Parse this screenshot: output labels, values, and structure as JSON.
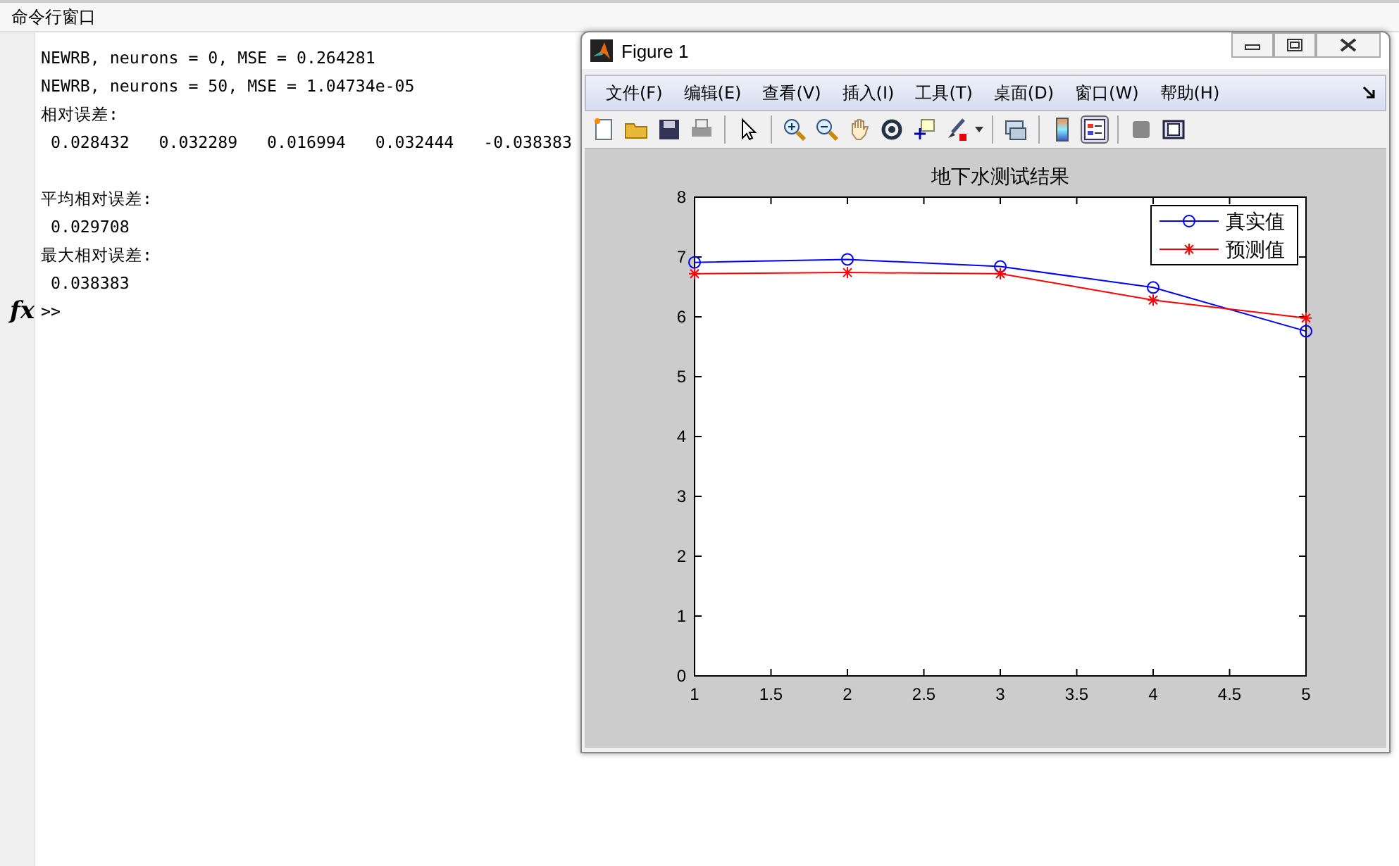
{
  "command_window": {
    "title": "命令行窗口",
    "blocks": [
      [
        "NEWRB, neurons = 0, MSE = 0.264281",
        "NEWRB, neurons = 50, MSE = 1.04734e-05",
        "相对误差:",
        " 0.028432   0.032289   0.016994   0.032444   -0.038383"
      ],
      [
        "平均相对误差:",
        " 0.029708",
        "最大相对误差:",
        " 0.038383"
      ]
    ],
    "prompt_icon": "fx",
    "prompt": ">>"
  },
  "figure": {
    "title": "Figure 1",
    "menu": [
      "文件(F)",
      "编辑(E)",
      "查看(V)",
      "插入(I)",
      "工具(T)",
      "桌面(D)",
      "窗口(W)",
      "帮助(H)"
    ],
    "toolbar": [
      {
        "kind": "new",
        "selected": false
      },
      {
        "kind": "open",
        "selected": false
      },
      {
        "kind": "save",
        "selected": false
      },
      {
        "kind": "print",
        "selected": false
      },
      {
        "kind": "separator"
      },
      {
        "kind": "pointer",
        "selected": false
      },
      {
        "kind": "separator"
      },
      {
        "kind": "zoom-in",
        "selected": false
      },
      {
        "kind": "zoom-out",
        "selected": false
      },
      {
        "kind": "pan",
        "selected": false
      },
      {
        "kind": "rotate",
        "selected": false
      },
      {
        "kind": "data-cursor",
        "selected": false
      },
      {
        "kind": "brush",
        "selected": false
      },
      {
        "kind": "separator"
      },
      {
        "kind": "link",
        "selected": false
      },
      {
        "kind": "separator"
      },
      {
        "kind": "colorbar",
        "selected": false
      },
      {
        "kind": "legend",
        "selected": true
      },
      {
        "kind": "separator"
      },
      {
        "kind": "hide-tools",
        "selected": false
      },
      {
        "kind": "show-tools",
        "selected": false
      }
    ],
    "chart_data": {
      "type": "line",
      "title": "地下水测试结果",
      "x": [
        1,
        2,
        3,
        4,
        5
      ],
      "xlim": [
        1,
        5
      ],
      "ylim": [
        0,
        8
      ],
      "xticks": [
        1,
        1.5,
        2,
        2.5,
        3,
        3.5,
        4,
        4.5,
        5
      ],
      "yticks": [
        0,
        1,
        2,
        3,
        4,
        5,
        6,
        7,
        8
      ],
      "legend": true,
      "series": [
        {
          "name": "真实值",
          "color": "#0000ff",
          "marker": "circle",
          "values": [
            6.91,
            6.96,
            6.84,
            6.49,
            5.76
          ]
        },
        {
          "name": "预测值",
          "color": "#ff0000",
          "marker": "cross",
          "values": [
            6.72,
            6.74,
            6.72,
            6.28,
            5.98
          ]
        }
      ]
    }
  }
}
